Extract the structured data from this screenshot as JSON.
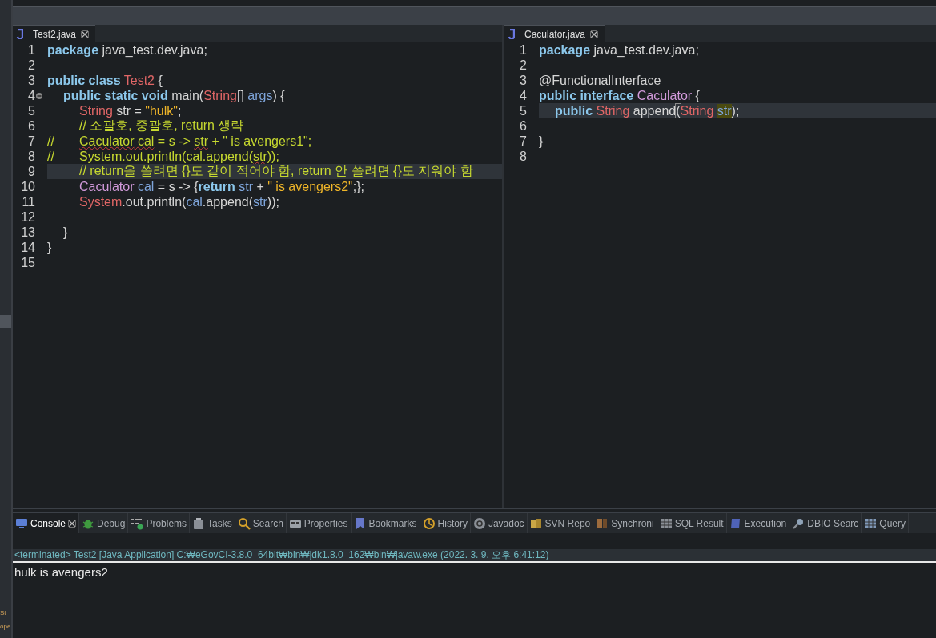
{
  "side_strip": {
    "texts": [
      "St",
      "ope"
    ]
  },
  "editors": [
    {
      "tab": {
        "title": "Test2.java",
        "selected": true
      },
      "lines": [
        {
          "number": "1",
          "current": false,
          "fold": false,
          "tokens": [
            {
              "text": "package",
              "kind": "keyword"
            },
            {
              "text": " java_test.dev.java;",
              "kind": "plain"
            }
          ]
        },
        {
          "number": "2",
          "current": false,
          "fold": false
        },
        {
          "number": "3",
          "current": false,
          "fold": false,
          "tokens": [
            {
              "text": "public class",
              "kind": "keyword"
            },
            {
              "text": " Test2",
              "kind": "type"
            },
            {
              "text": " {",
              "kind": "plain"
            }
          ]
        },
        {
          "number": "4",
          "current": false,
          "fold": true,
          "tokens": [
            {
              "text": "\tpublic static void",
              "kind": "keyword"
            },
            {
              "text": " main(",
              "kind": "plain"
            },
            {
              "text": "String",
              "kind": "type"
            },
            {
              "text": "[] ",
              "kind": "plain"
            },
            {
              "text": "args",
              "kind": "var"
            },
            {
              "text": ") {",
              "kind": "plain"
            }
          ]
        },
        {
          "number": "5",
          "current": false,
          "fold": false,
          "tokens": [
            {
              "text": "\t\tString",
              "kind": "type"
            },
            {
              "text": " str = ",
              "kind": "plain"
            },
            {
              "text": "\"hulk\"",
              "kind": "string"
            },
            {
              "text": ";",
              "kind": "plain"
            }
          ]
        },
        {
          "number": "6",
          "current": false,
          "fold": false,
          "tokens": [
            {
              "text": "\t\t// 소괄호, 중괄호, return 생략",
              "kind": "comment"
            }
          ]
        },
        {
          "number": "7",
          "current": false,
          "fold": false,
          "tokens": [
            {
              "text": "//\t\t",
              "kind": "comment"
            },
            {
              "text": "Caculator",
              "kind": "squiggle"
            },
            {
              "text": " cal",
              "kind": "squiggle"
            },
            {
              "text": " = s -> ",
              "kind": "comment"
            },
            {
              "text": "str",
              "kind": "squiggle"
            },
            {
              "text": " + \" is avengers1\";",
              "kind": "comment"
            }
          ]
        },
        {
          "number": "8",
          "current": false,
          "fold": false,
          "tokens": [
            {
              "text": "//\t\tSystem.out.println(cal.append(",
              "kind": "comment"
            },
            {
              "text": "str",
              "kind": "squiggle"
            },
            {
              "text": "));",
              "kind": "comment"
            }
          ]
        },
        {
          "number": "9",
          "current": true,
          "fold": false,
          "tokens": [
            {
              "text": "\t\t// return을 쓸려면 {}도 같이 적어야 함, return 안 쓸려면 {}도 지워야 함",
              "kind": "comment"
            }
          ]
        },
        {
          "number": "10",
          "current": false,
          "fold": false,
          "tokens": [
            {
              "text": "\t\tCaculator",
              "kind": "iface"
            },
            {
              "text": " cal",
              "kind": "var"
            },
            {
              "text": " = s -> {",
              "kind": "plain"
            },
            {
              "text": "return",
              "kind": "keyword"
            },
            {
              "text": " str",
              "kind": "var"
            },
            {
              "text": " + ",
              "kind": "plain"
            },
            {
              "text": "\" is avengers2\"",
              "kind": "string"
            },
            {
              "text": ";};",
              "kind": "plain"
            }
          ]
        },
        {
          "number": "11",
          "current": false,
          "fold": false,
          "tokens": [
            {
              "text": "\t\tSystem",
              "kind": "type"
            },
            {
              "text": ".out.println(",
              "kind": "plain"
            },
            {
              "text": "cal",
              "kind": "var"
            },
            {
              "text": ".append(",
              "kind": "plain"
            },
            {
              "text": "str",
              "kind": "var"
            },
            {
              "text": "));",
              "kind": "plain"
            }
          ]
        },
        {
          "number": "12",
          "current": false,
          "fold": false
        },
        {
          "number": "13",
          "current": false,
          "fold": false,
          "tokens": [
            {
              "text": "\t}",
              "kind": "plain"
            }
          ]
        },
        {
          "number": "14",
          "current": false,
          "fold": false,
          "tokens": [
            {
              "text": "}",
              "kind": "plain"
            }
          ]
        },
        {
          "number": "15",
          "current": false,
          "fold": false
        }
      ]
    },
    {
      "tab": {
        "title": "Caculator.java",
        "selected": true
      },
      "lines": [
        {
          "number": "1",
          "current": false,
          "fold": false,
          "tokens": [
            {
              "text": "package",
              "kind": "keyword"
            },
            {
              "text": " java_test.dev.java;",
              "kind": "plain"
            }
          ]
        },
        {
          "number": "2",
          "current": false,
          "fold": false
        },
        {
          "number": "3",
          "current": false,
          "fold": false,
          "tokens": [
            {
              "text": "@FunctionalInterface",
              "kind": "plain"
            }
          ]
        },
        {
          "number": "4",
          "current": false,
          "fold": false,
          "tokens": [
            {
              "text": "public interface",
              "kind": "keyword"
            },
            {
              "text": " Caculator",
              "kind": "iface"
            },
            {
              "text": " {",
              "kind": "plain"
            }
          ]
        },
        {
          "number": "5",
          "current": true,
          "fold": false,
          "tokens": [
            {
              "text": "\tpublic",
              "kind": "keyword"
            },
            {
              "text": " String",
              "kind": "type"
            },
            {
              "text": " append",
              "kind": "plain"
            },
            {
              "text": "(",
              "kind": "match"
            },
            {
              "text": "String ",
              "kind": "type"
            },
            {
              "text": "str",
              "kind": "marked"
            },
            {
              "text": ");",
              "kind": "plain"
            }
          ]
        },
        {
          "number": "6",
          "current": false,
          "fold": false
        },
        {
          "number": "7",
          "current": false,
          "fold": false,
          "tokens": [
            {
              "text": "}",
              "kind": "plain"
            }
          ]
        },
        {
          "number": "8",
          "current": false,
          "fold": false
        }
      ]
    }
  ],
  "console": {
    "tabs": [
      {
        "label": "Console",
        "selected": true
      },
      {
        "label": "Debug",
        "selected": false
      },
      {
        "label": "Problems",
        "selected": false
      },
      {
        "label": "Tasks",
        "selected": false
      },
      {
        "label": "Search",
        "selected": false
      },
      {
        "label": "Properties",
        "selected": false
      },
      {
        "label": "Bookmarks",
        "selected": false
      },
      {
        "label": "History",
        "selected": false
      },
      {
        "label": "Javadoc",
        "selected": false
      },
      {
        "label": "SVN Repo",
        "selected": false
      },
      {
        "label": "Synchroni",
        "selected": false
      },
      {
        "label": "SQL Result",
        "selected": false
      },
      {
        "label": "Execution",
        "selected": false
      },
      {
        "label": "DBIO Searc",
        "selected": false
      },
      {
        "label": "Query",
        "selected": false
      }
    ],
    "header": "<terminated> Test2 [Java Application] C:₩eGovCI-3.8.0_64bit₩bin₩jdk1.8.0_162₩bin₩javaw.exe (2022. 3. 9. 오후 6:41:12)",
    "output": "hulk is avengers2"
  }
}
